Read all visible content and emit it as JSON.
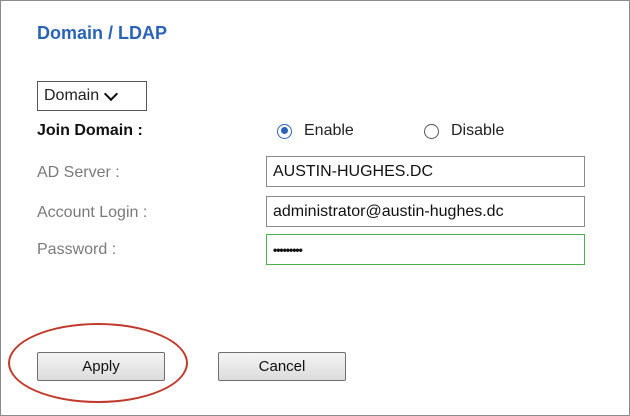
{
  "header": {
    "title": "Domain / LDAP"
  },
  "mode_select": {
    "value": "Domain"
  },
  "join_domain": {
    "label": "Join Domain :",
    "options": [
      {
        "label": "Enable",
        "selected": true
      },
      {
        "label": "Disable",
        "selected": false
      }
    ]
  },
  "fields": {
    "ad_server": {
      "label": "AD Server :",
      "value": "AUSTIN-HUGHES.DC"
    },
    "account_login": {
      "label": "Account Login :",
      "value": "administrator@austin-hughes.dc"
    },
    "password": {
      "label": "Password :",
      "value": "•••••••••"
    }
  },
  "buttons": {
    "apply": "Apply",
    "cancel": "Cancel"
  },
  "colors": {
    "accent": "#2b63b6",
    "focus_border": "#4caf50",
    "annotation": "#c0392b"
  }
}
